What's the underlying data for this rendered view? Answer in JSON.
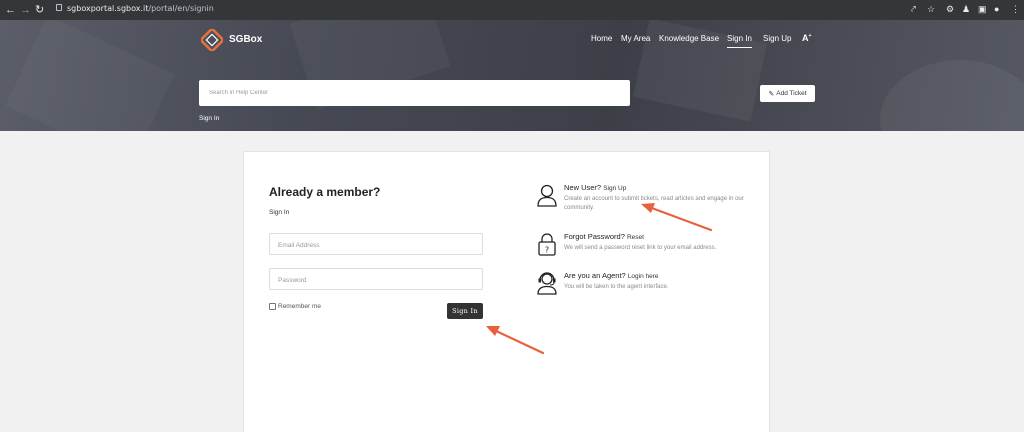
{
  "browser": {
    "url_host": "sgboxportal.sgbox.it",
    "url_path": "/portal/en/signin",
    "icons": [
      "back-arrow-icon",
      "forward-arrow-icon",
      "reload-icon",
      "lock-icon",
      "share-icon",
      "star-icon",
      "extensions-icon",
      "profile-icon",
      "sidebar-icon",
      "account-icon",
      "menu-icon"
    ]
  },
  "header": {
    "logo_text": "SGBox",
    "nav": [
      "Home",
      "My Area",
      "Knowledge Base",
      "Sign In",
      "Sign Up"
    ],
    "active_nav": "Sign In",
    "font_toggle": "A",
    "search_placeholder": "Search in Help Center",
    "add_ticket_label": "Add Ticket",
    "breadcrumb": "Sign In",
    "colors": {
      "logo_accent": "#e8713c",
      "hero": "#464953"
    }
  },
  "signin": {
    "title": "Already a member?",
    "subtitle": "Sign In",
    "email_placeholder": "Email Address",
    "password_placeholder": "Password",
    "remember_label": "Remember me",
    "submit_label": "Sign In"
  },
  "options": {
    "new_user": {
      "title": "New User?",
      "link": "Sign Up",
      "desc": "Create an account to submit tickets, read articles and engage in our community.",
      "icon": "user-icon"
    },
    "forgot": {
      "title": "Forgot Password?",
      "link": "Reset",
      "desc": "We will send a password reset link to your email address.",
      "icon": "padlock-icon"
    },
    "agent": {
      "title": "Are you an Agent?",
      "link": "Login here",
      "desc": "You will be taken to the agent interface.",
      "icon": "headset-icon"
    }
  },
  "annotations": {
    "arrow_color": "#e8603c"
  }
}
